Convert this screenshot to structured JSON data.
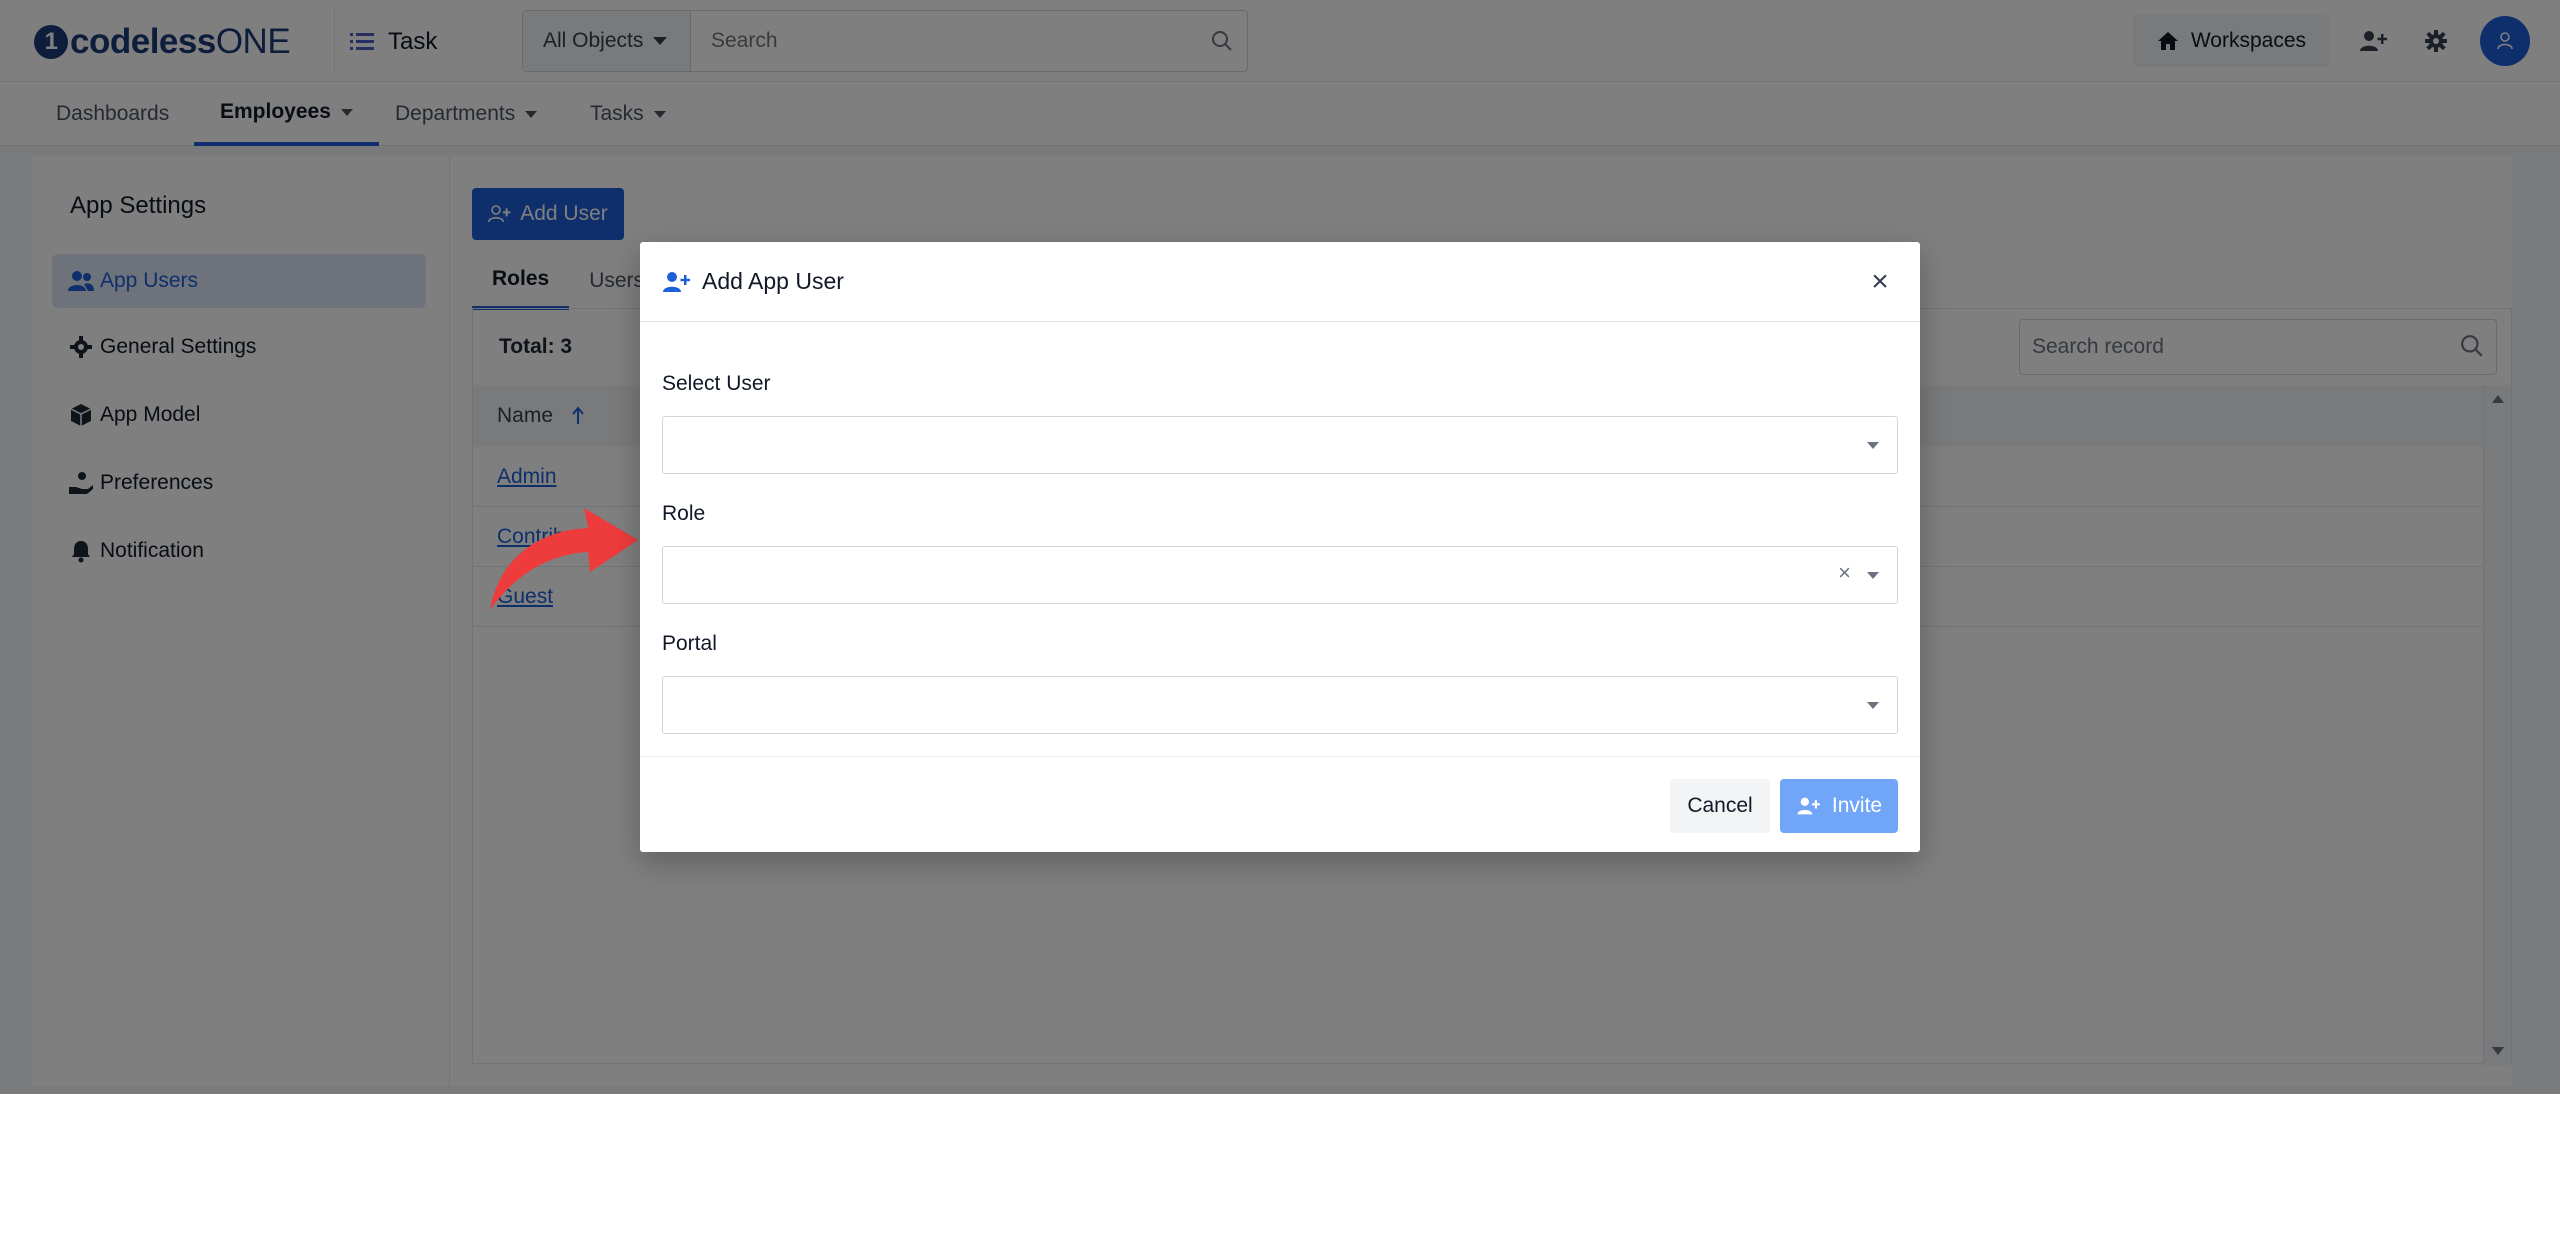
{
  "brand": {
    "logo_mark": "1",
    "logo_name_bold": "codeless",
    "logo_name_light": "ONE"
  },
  "header": {
    "app_name": "Task",
    "object_selector": "All Objects",
    "search_placeholder": "Search",
    "workspaces_label": "Workspaces"
  },
  "nav": {
    "items": [
      {
        "label": "Dashboards"
      },
      {
        "label": "Employees"
      },
      {
        "label": "Departments"
      },
      {
        "label": "Tasks"
      }
    ]
  },
  "sidebar": {
    "title": "App Settings",
    "items": [
      {
        "label": "App Users",
        "icon": "users-icon"
      },
      {
        "label": "General Settings",
        "icon": "gear-icon"
      },
      {
        "label": "App Model",
        "icon": "cube-icon"
      },
      {
        "label": "Preferences",
        "icon": "hand-icon"
      },
      {
        "label": "Notification",
        "icon": "bell-icon"
      }
    ]
  },
  "main": {
    "add_user_label": "Add User",
    "tabs": [
      {
        "label": "Roles"
      },
      {
        "label": "Users"
      }
    ],
    "total_label": "Total: 3",
    "search_placeholder": "Search record",
    "column_name": "Name",
    "rows": [
      {
        "name": "Admin"
      },
      {
        "name": "Contributor"
      },
      {
        "name": "Guest"
      }
    ]
  },
  "modal": {
    "title": "Add App User",
    "close_symbol": "×",
    "fields": {
      "select_user_label": "Select User",
      "role_label": "Role",
      "portal_label": "Portal",
      "clear_symbol": "×"
    },
    "cancel_label": "Cancel",
    "invite_label": "Invite"
  },
  "colors": {
    "primary": "#1d5fd6",
    "invite_disabled": "#70a5f7",
    "annotation_arrow": "#ee3b3b"
  }
}
